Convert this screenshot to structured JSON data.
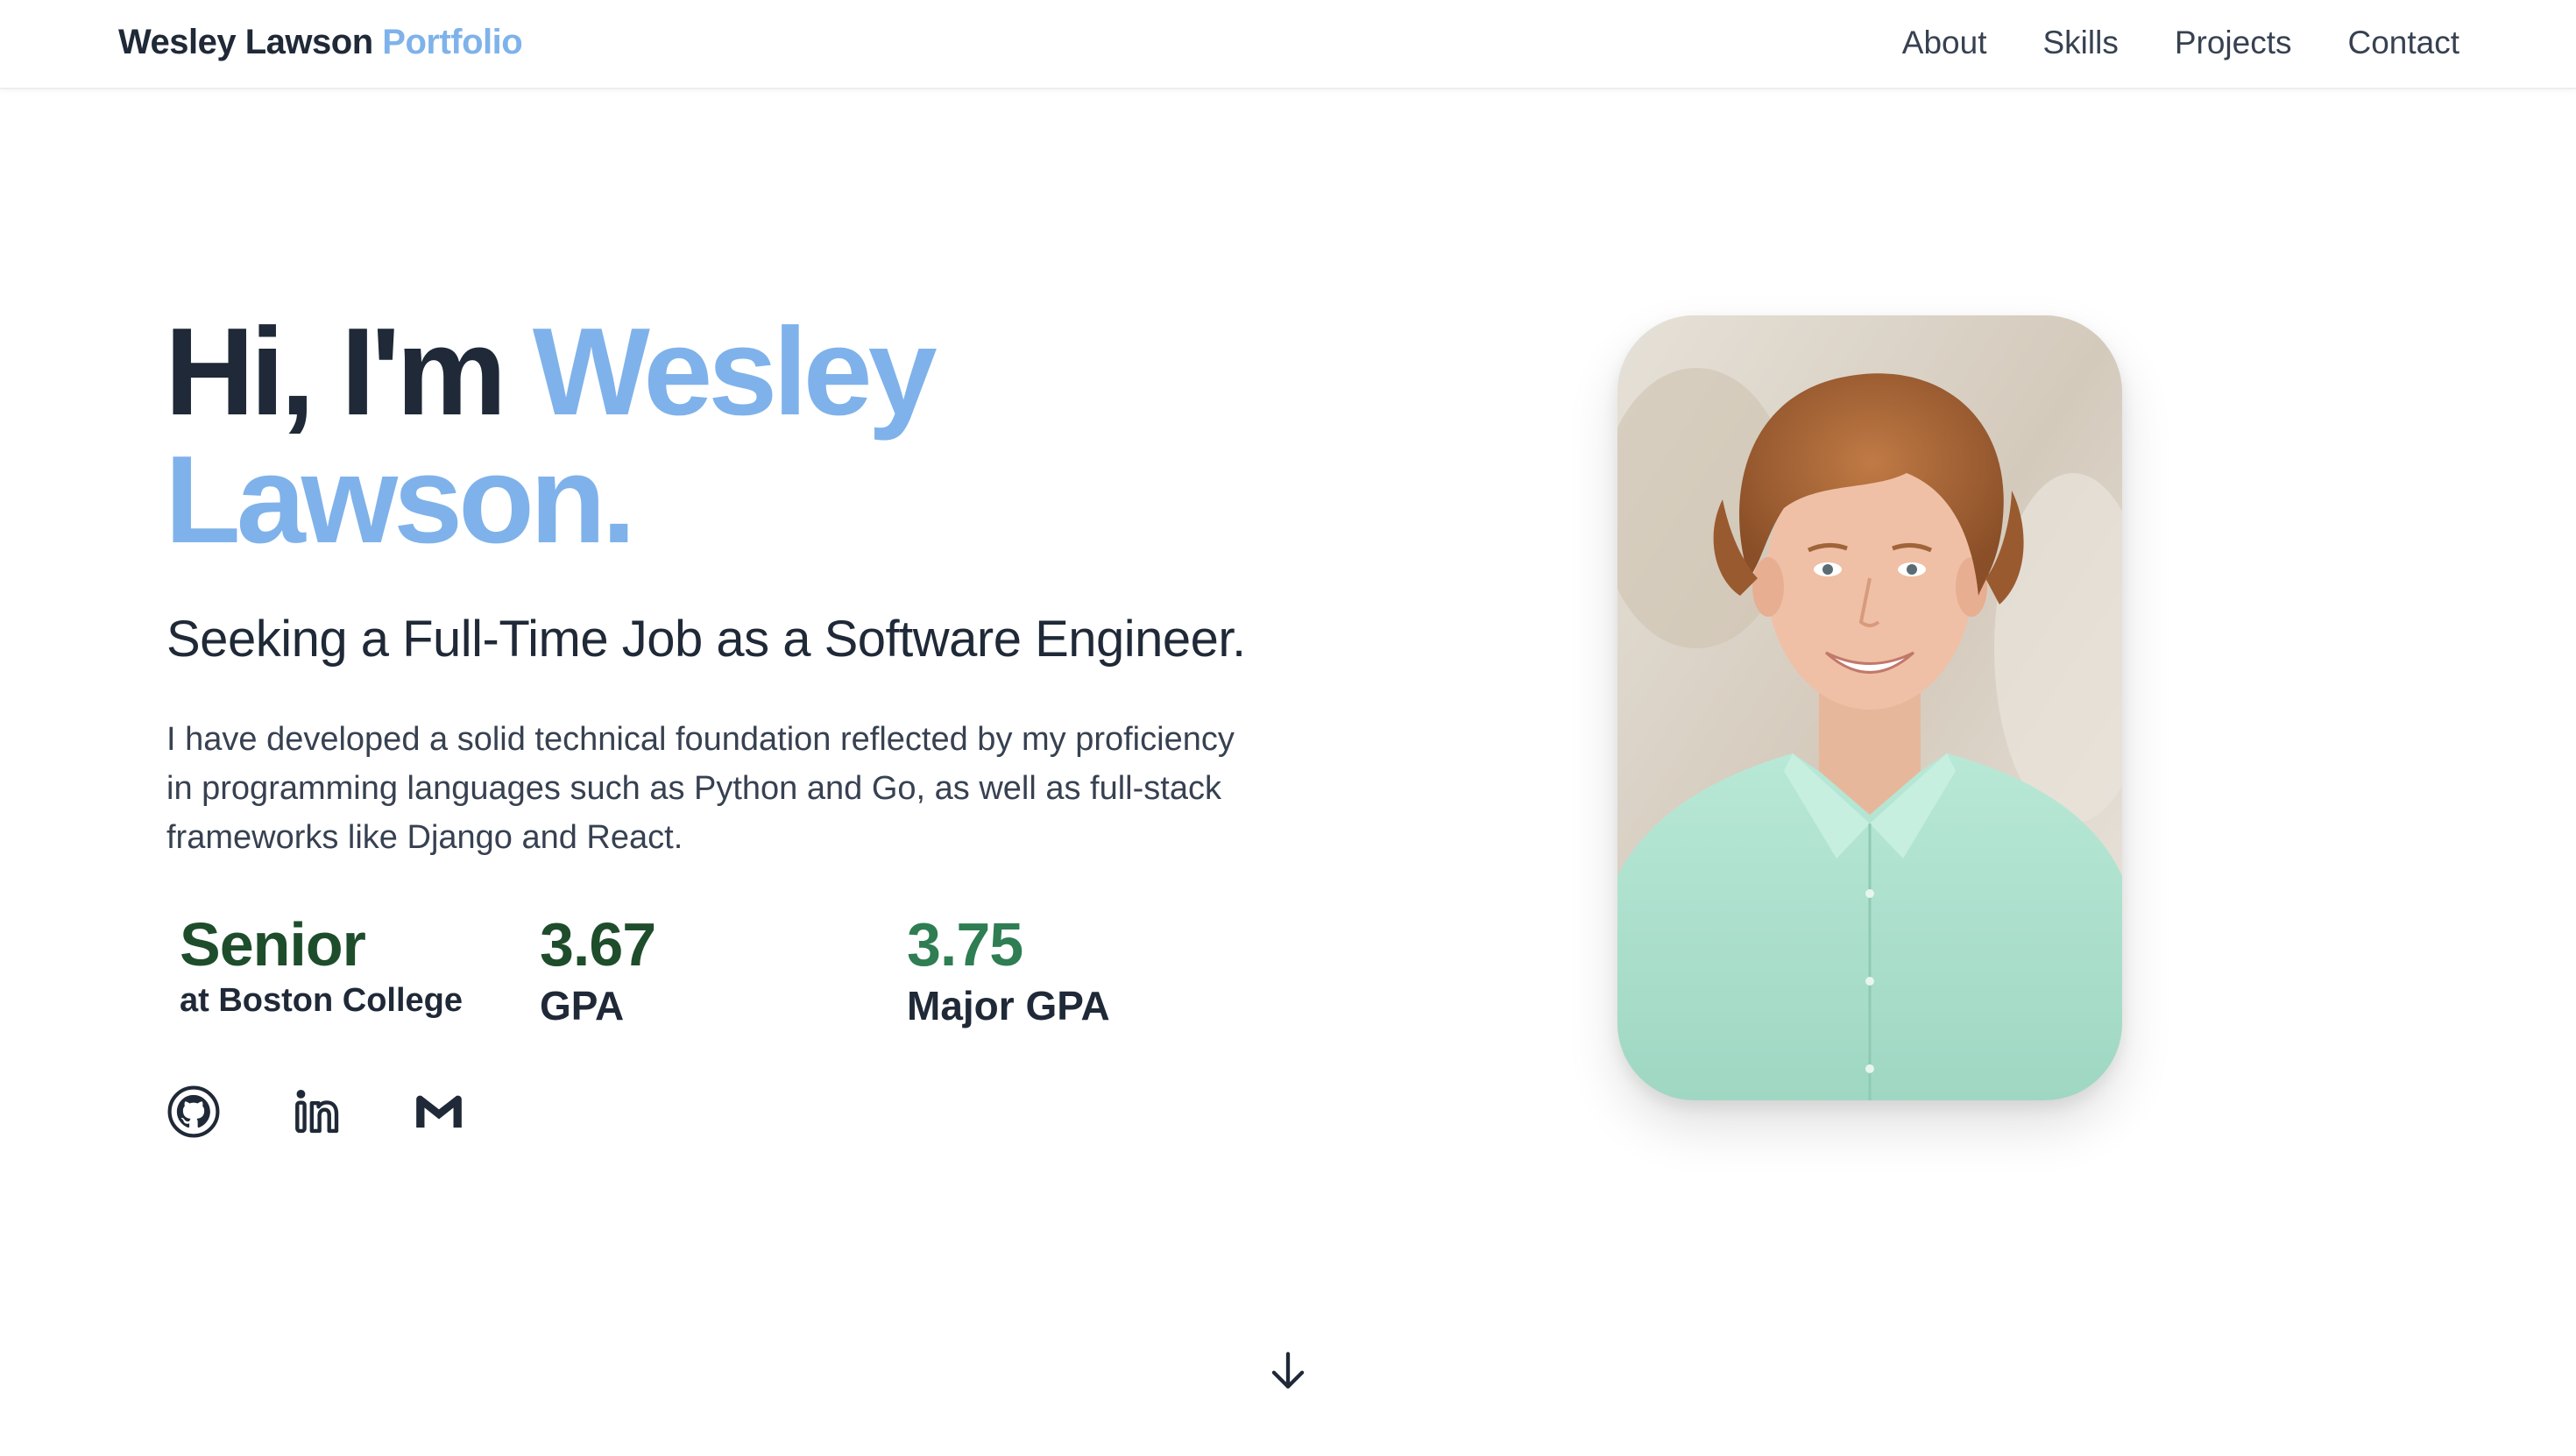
{
  "nav": {
    "brand_name": "Wesley Lawson",
    "brand_accent": "Portfolio",
    "links": [
      "About",
      "Skills",
      "Projects",
      "Contact"
    ]
  },
  "hero": {
    "greeting": "Hi, I'm",
    "first_name": "Wesley",
    "last_name": "Lawson.",
    "subtitle": "Seeking a Full-Time Job as a Software Engineer.",
    "description": "I have developed a solid technical foundation reflected by my proficiency in programming languages such as Python and Go, as well as full-stack frameworks like Django and React."
  },
  "stats": [
    {
      "value": "Senior",
      "label": "at Boston College"
    },
    {
      "value": "3.67",
      "label": "GPA"
    },
    {
      "value": "3.75",
      "label": "Major GPA"
    }
  ],
  "social": [
    {
      "icon": "github-icon"
    },
    {
      "icon": "linkedin-icon"
    },
    {
      "icon": "gmail-icon"
    }
  ],
  "colors": {
    "accent": "#7fb2ea",
    "text_dark": "#1f2937",
    "stat_dark_green": "#1e4d2b",
    "stat_green": "#2f7d52",
    "shirt_mint": "#a9e0cb",
    "hair": "#a9653a"
  },
  "portrait": {
    "subject": "headshot portrait"
  }
}
